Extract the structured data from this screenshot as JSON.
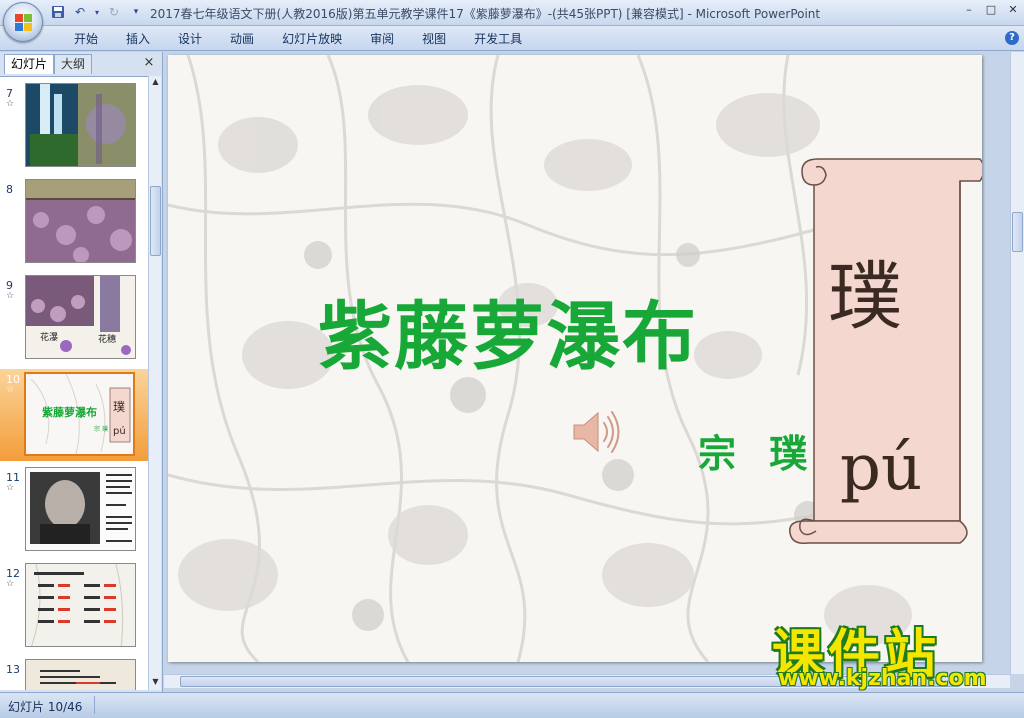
{
  "window": {
    "title": "2017春七年级语文下册(人教2016版)第五单元教学课件17《紫藤萝瀑布》-(共45张PPT) [兼容模式] - Microsoft PowerPoint",
    "controls": [
      "–",
      "□",
      "✕"
    ]
  },
  "ribbon": {
    "tabs": [
      "开始",
      "插入",
      "设计",
      "动画",
      "幻灯片放映",
      "审阅",
      "视图",
      "开发工具"
    ],
    "help": "?"
  },
  "left_pane": {
    "tabs": [
      "幻灯片",
      "大纲"
    ],
    "close": "×",
    "thumbnails": [
      {
        "num": "7",
        "selected": false
      },
      {
        "num": "8",
        "selected": false
      },
      {
        "num": "9",
        "selected": false,
        "labels": [
          "花瀑",
          "花穗"
        ]
      },
      {
        "num": "10",
        "selected": true,
        "mini_title": "紫藤萝瀑布",
        "mini_char": "璞",
        "mini_pinyin": "pú",
        "mini_author": "宗璞"
      },
      {
        "num": "11",
        "selected": false
      },
      {
        "num": "12",
        "selected": false
      },
      {
        "num": "13",
        "selected": false
      }
    ]
  },
  "slide": {
    "title": "紫藤萝瀑布",
    "author": "宗 璞",
    "scroll_char": "璞",
    "scroll_pinyin": "pú"
  },
  "status": {
    "slide_counter": "幻灯片 10/46"
  },
  "watermark": {
    "cn": "课件站",
    "url": "www.kjzhan.com"
  },
  "colors": {
    "title_green": "#18a838",
    "scroll_fill": "#f4d7cf",
    "selection_orange": "#f39d3a"
  }
}
